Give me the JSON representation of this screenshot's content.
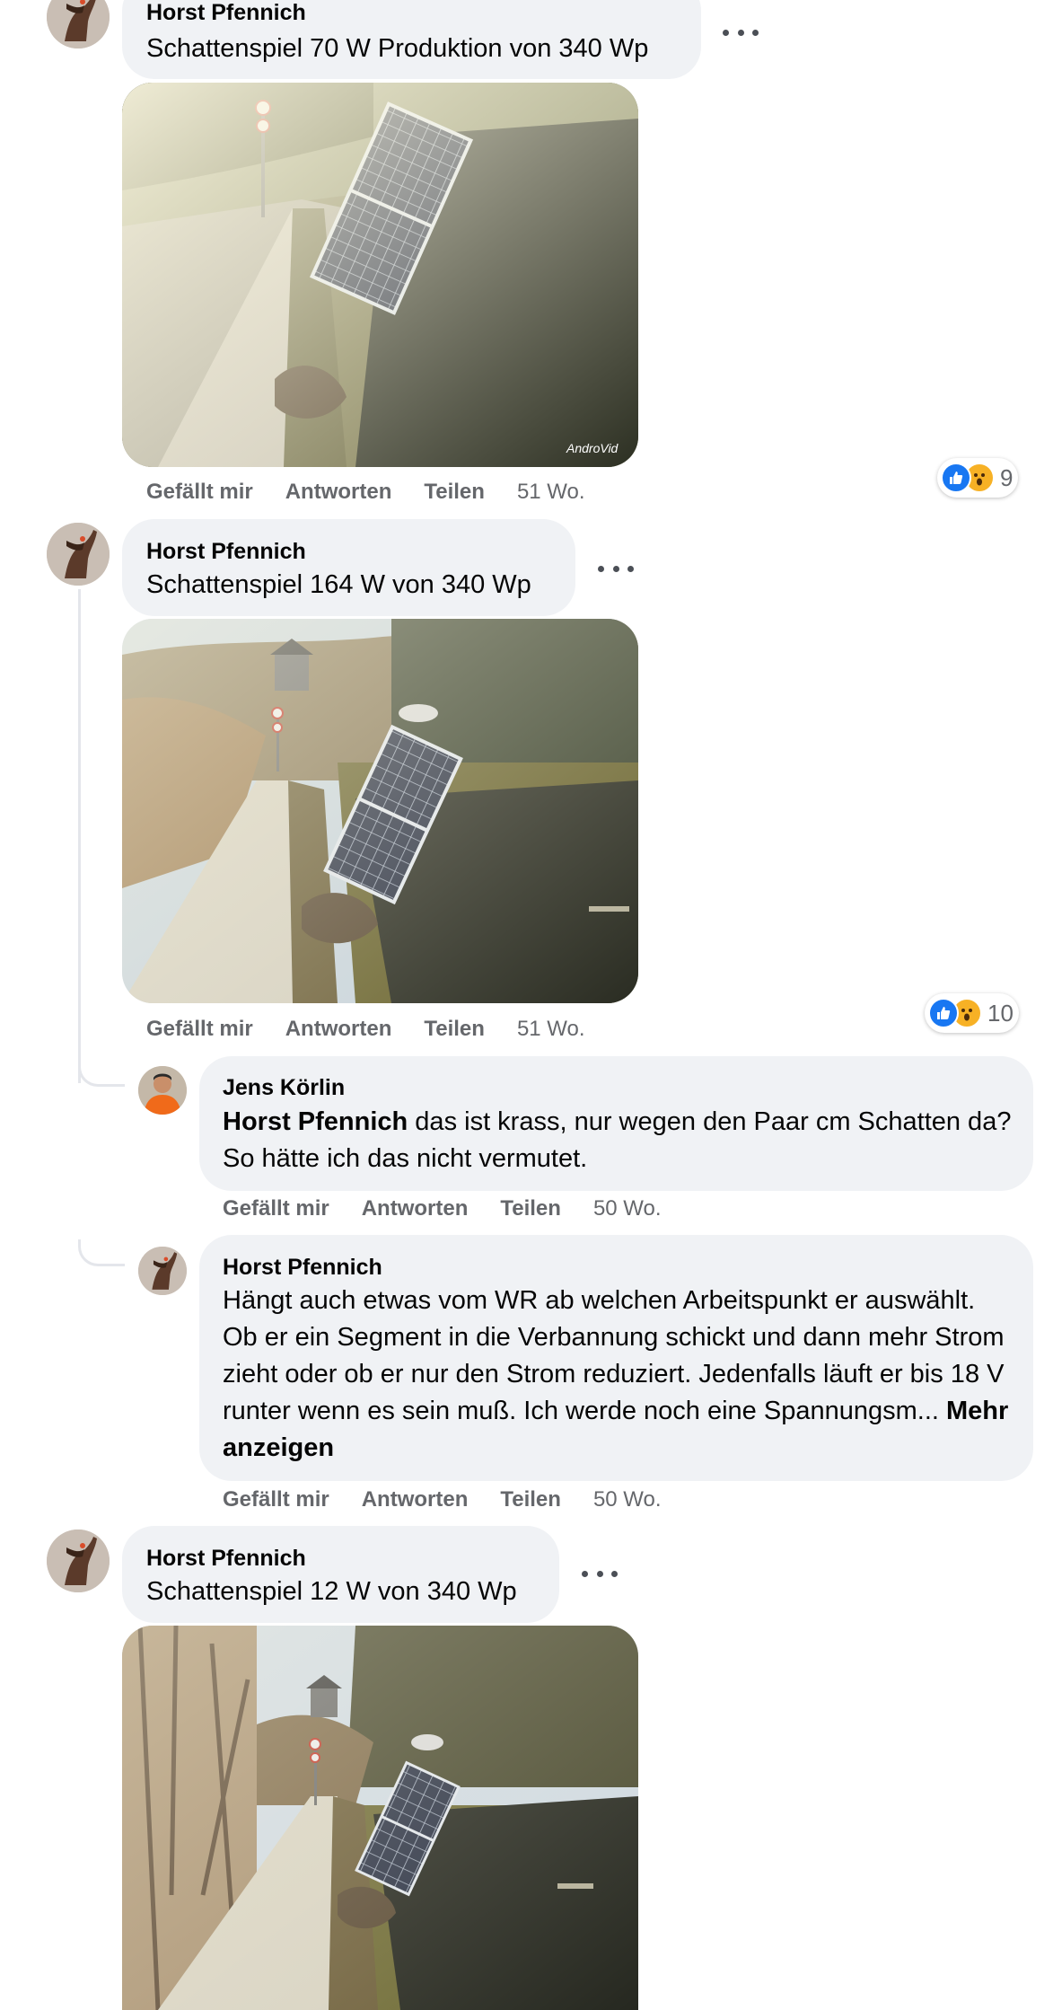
{
  "colors": {
    "bubble_bg": "#f0f2f5",
    "secondary_text": "#65676b",
    "like_blue": "#1877f2",
    "wow_yellow": "#f7b125"
  },
  "actions": {
    "like": "Gefällt mir",
    "reply": "Antworten",
    "share": "Teilen"
  },
  "comments": [
    {
      "author": "Horst Pfennich",
      "text": "Schattenspiel 70 W Produktion von 340 Wp",
      "image_watermark": "AndroVid",
      "time": "51 Wo.",
      "reaction_icons": [
        "like-icon",
        "wow-icon"
      ],
      "reaction_count": "9"
    },
    {
      "author": "Horst Pfennich",
      "text": "Schattenspiel 164 W von 340 Wp",
      "time": "51 Wo.",
      "reaction_icons": [
        "like-icon",
        "wow-icon"
      ],
      "reaction_count": "10",
      "replies": [
        {
          "author": "Jens Körlin",
          "mention": "Horst Pfennich",
          "text": " das ist krass, nur wegen den Paar cm Schatten da? So hätte ich das nicht vermutet.",
          "time": "50 Wo."
        },
        {
          "author": "Horst Pfennich",
          "text": "Hängt auch etwas vom WR ab welchen Arbeitspunkt er auswählt. Ob er ein Segment in die Verbannung schickt und dann mehr Strom zieht oder ob er nur den Strom reduziert. Jedenfalls läuft er bis 18 V runter wenn es sein muß. Ich werde noch eine Spannungsm... ",
          "see_more": "Mehr anzeigen",
          "time": "50 Wo."
        }
      ]
    },
    {
      "author": "Horst Pfennich",
      "text": "Schattenspiel 12 W von 340 Wp"
    }
  ]
}
